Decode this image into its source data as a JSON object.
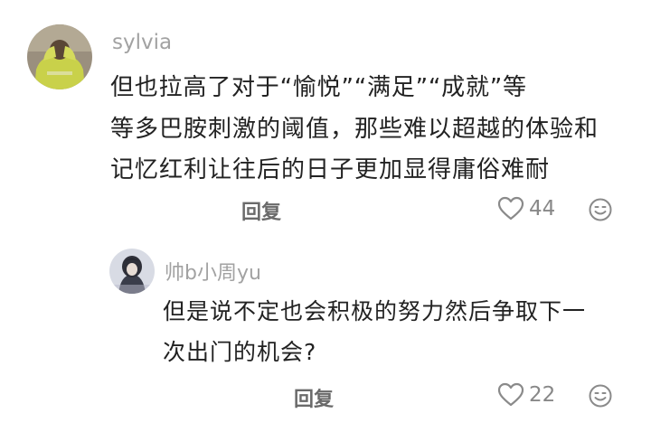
{
  "comments": [
    {
      "username": "sylvia",
      "lines": [
        "但也拉高了对于“愉悦”“满足”“成就”等",
        "等多巴胺刺激的阈值，那些难以超越的体验和",
        "记忆红利让往后的日子更加显得庸俗难耐"
      ],
      "reply_label": "回复",
      "like_count": "44",
      "icons": {
        "like": "heart-outline-icon",
        "emoji": "smiley-face-icon"
      }
    },
    {
      "username": "帅b小周yu",
      "lines": [
        "但是说不定也会积极的努力然后争取下一",
        "次出门的机会?"
      ],
      "reply_label": "回复",
      "like_count": "22",
      "icons": {
        "like": "heart-outline-icon",
        "emoji": "smiley-face-icon"
      }
    }
  ]
}
